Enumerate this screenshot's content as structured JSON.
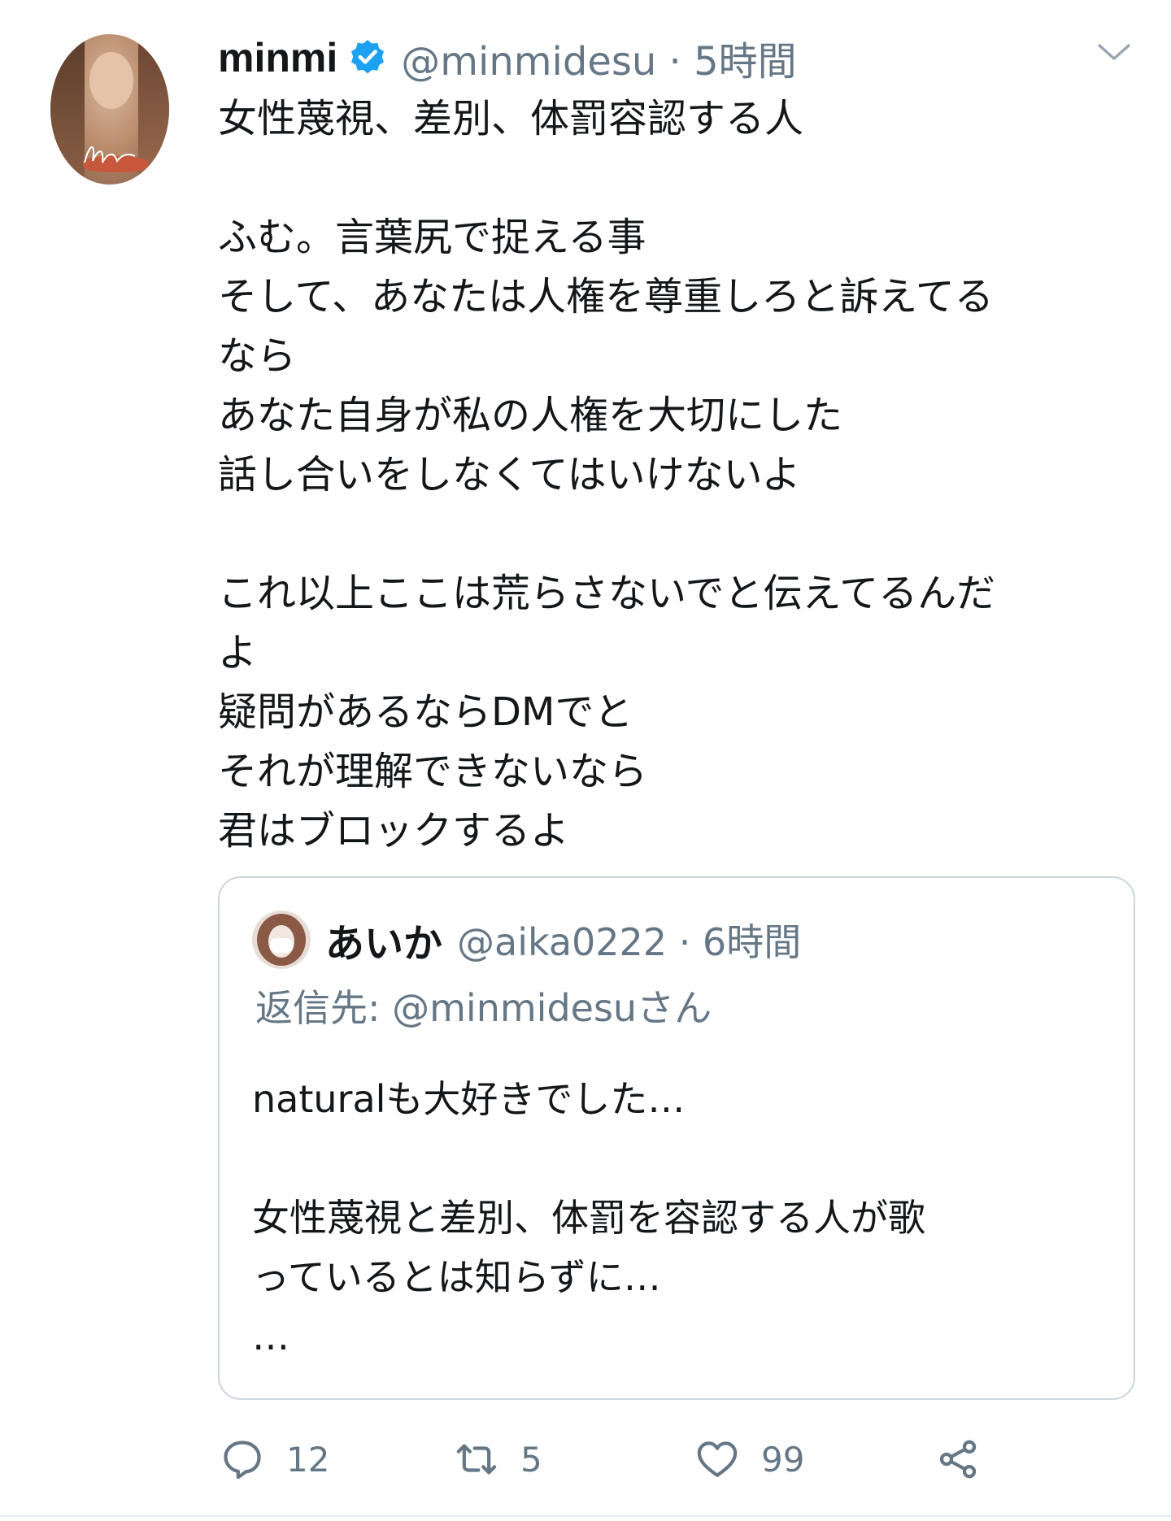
{
  "tweet": {
    "author": {
      "name": "minmi",
      "handle_time": "@minmidesu · 5時間",
      "verified": true,
      "avatar_icon": "user-avatar-photo"
    },
    "menu_icon": "chevron-down-icon",
    "text": "女性蔑視、差別、体罰容認する人\n\nふむ。言葉尻で捉える事\nそして、あなたは人権を尊重しろと訴えてる\nなら\nあなた自身が私の人権を大切にした\n話し合いをしなくてはいけないよ\n\nこれ以上ここは荒らさないでと伝えてるんだ\nよ\n疑問があるならDMでと\nそれが理解できないなら\n君はブロックするよ"
  },
  "quoted_tweet": {
    "author": {
      "name": "あいか",
      "handle_time": "@aika0222 · 6時間",
      "avatar_icon": "user-avatar-photo"
    },
    "reply_to": "返信先: @minmidesuさん",
    "text": "naturalも大好きでした…\n\n女性蔑視と差別、体罰を容認する人が歌\nっているとは知らずに…\n…"
  },
  "actions": {
    "reply": {
      "icon": "reply-icon",
      "count": "12"
    },
    "retweet": {
      "icon": "retweet-icon",
      "count": "5"
    },
    "like": {
      "icon": "heart-icon",
      "count": "99"
    },
    "share": {
      "icon": "share-icon"
    }
  },
  "colors": {
    "primary_text": "#14171a",
    "secondary_text": "#657786",
    "verified_blue": "#1da1f2",
    "border": "#ccd6dd"
  }
}
